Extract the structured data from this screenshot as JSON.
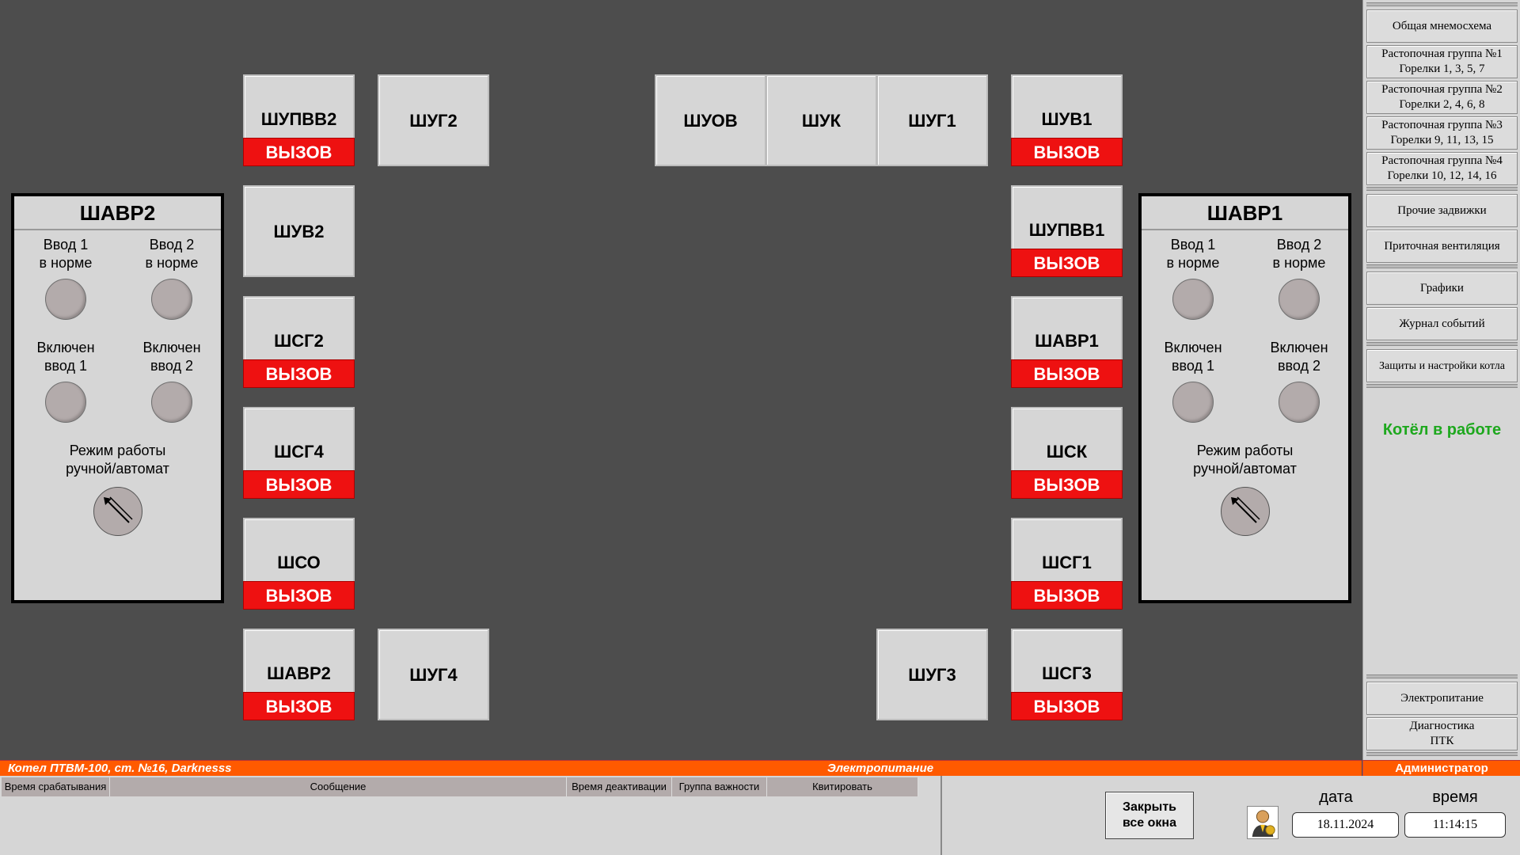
{
  "cabinets": {
    "shupvv2": {
      "name": "ШУПВВ2",
      "call": "ВЫЗОВ"
    },
    "shug2": {
      "name": "ШУГ2"
    },
    "shuov": {
      "name": "ШУОВ"
    },
    "shuk": {
      "name": "ШУК"
    },
    "shug1": {
      "name": "ШУГ1"
    },
    "shuv1": {
      "name": "ШУВ1",
      "call": "ВЫЗОВ"
    },
    "shuv2": {
      "name": "ШУВ2"
    },
    "shupvv1": {
      "name": "ШУПВВ1",
      "call": "ВЫЗОВ"
    },
    "shsg2": {
      "name": "ШСГ2",
      "call": "ВЫЗОВ"
    },
    "shavr1": {
      "name": "ШАВР1",
      "call": "ВЫЗОВ"
    },
    "shsg4": {
      "name": "ШСГ4",
      "call": "ВЫЗОВ"
    },
    "shsk": {
      "name": "ШСК",
      "call": "ВЫЗОВ"
    },
    "shso": {
      "name": "ШСО",
      "call": "ВЫЗОВ"
    },
    "shsg1": {
      "name": "ШСГ1",
      "call": "ВЫЗОВ"
    },
    "shavr2": {
      "name": "ШАВР2",
      "call": "ВЫЗОВ"
    },
    "shug4": {
      "name": "ШУГ4"
    },
    "shug3": {
      "name": "ШУГ3"
    },
    "shsg3": {
      "name": "ШСГ3",
      "call": "ВЫЗОВ"
    }
  },
  "abr_left": {
    "title": "ШАВР2",
    "input1": "Ввод 1\nв норме",
    "input2": "Ввод 2\nв норме",
    "on1": "Включен\nввод 1",
    "on2": "Включен\nввод 2",
    "mode": "Режим работы\nручной/автомат"
  },
  "abr_right": {
    "title": "ШАВР1",
    "input1": "Ввод 1\nв норме",
    "input2": "Ввод 2\nв норме",
    "on1": "Включен\nввод 1",
    "on2": "Включен\nввод 2",
    "mode": "Режим работы\nручной/автомат"
  },
  "menu": {
    "general": "Общая мнемосхема",
    "group1": "Растопочная группа №1\nГорелки 1, 3, 5, 7",
    "group2": "Растопочная группа №2\nГорелки 2, 4, 6, 8",
    "group3": "Растопочная группа №3\nГорелки 9, 11, 13, 15",
    "group4": "Растопочная группа №4\nГорелки 10, 12, 14, 16",
    "valves": "Прочие задвижки",
    "ventilation": "Приточная вентиляция",
    "charts": "Графики",
    "journal": "Журнал событий",
    "protection": "Защиты и настройки котла",
    "power": "Электропитание",
    "diagnostics": "Диагностика\nПТК"
  },
  "boiler_status": "Котёл в работе",
  "status": {
    "left": "Котел ПТВМ-100, ст. №16, Darknesss",
    "center": "Электропитание",
    "user": "Администратор"
  },
  "alarm_headers": [
    "Время срабатывания",
    "Сообщение",
    "Время деактивации",
    "Группа важности",
    "Квитировать"
  ],
  "close_button": "Закрыть\nвсе окна",
  "date_label": "дата",
  "time_label": "время",
  "date_value": "18.11.2024",
  "time_value": "11:14:15",
  "colors": {
    "call": "#ee1111",
    "status_bar": "#ff5a00",
    "boiler_ok": "#1ea81e",
    "background": "#4d4d4d"
  }
}
